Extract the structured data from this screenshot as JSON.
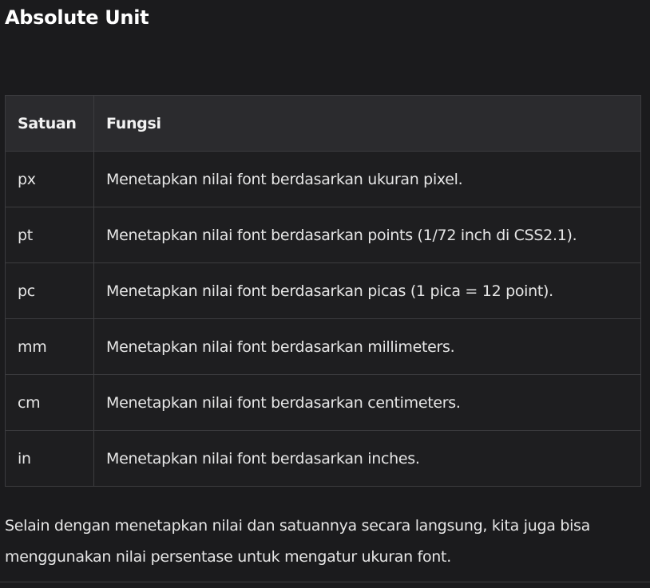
{
  "heading": "Absolute Unit",
  "table": {
    "headers": [
      "Satuan",
      "Fungsi"
    ],
    "rows": [
      [
        "px",
        "Menetapkan nilai font berdasarkan ukuran pixel."
      ],
      [
        "pt",
        "Menetapkan nilai font berdasarkan points (1/72 inch di CSS2.1)."
      ],
      [
        "pc",
        "Menetapkan nilai font berdasarkan picas (1 pica = 12 point)."
      ],
      [
        "mm",
        "Menetapkan nilai font berdasarkan millimeters."
      ],
      [
        "cm",
        "Menetapkan nilai font berdasarkan centimeters."
      ],
      [
        "in",
        "Menetapkan nilai font berdasarkan inches."
      ]
    ]
  },
  "paragraph": "Selain dengan menetapkan nilai dan satuannya secara langsung, kita juga bisa menggunakan nilai persentase untuk mengatur ukuran font."
}
